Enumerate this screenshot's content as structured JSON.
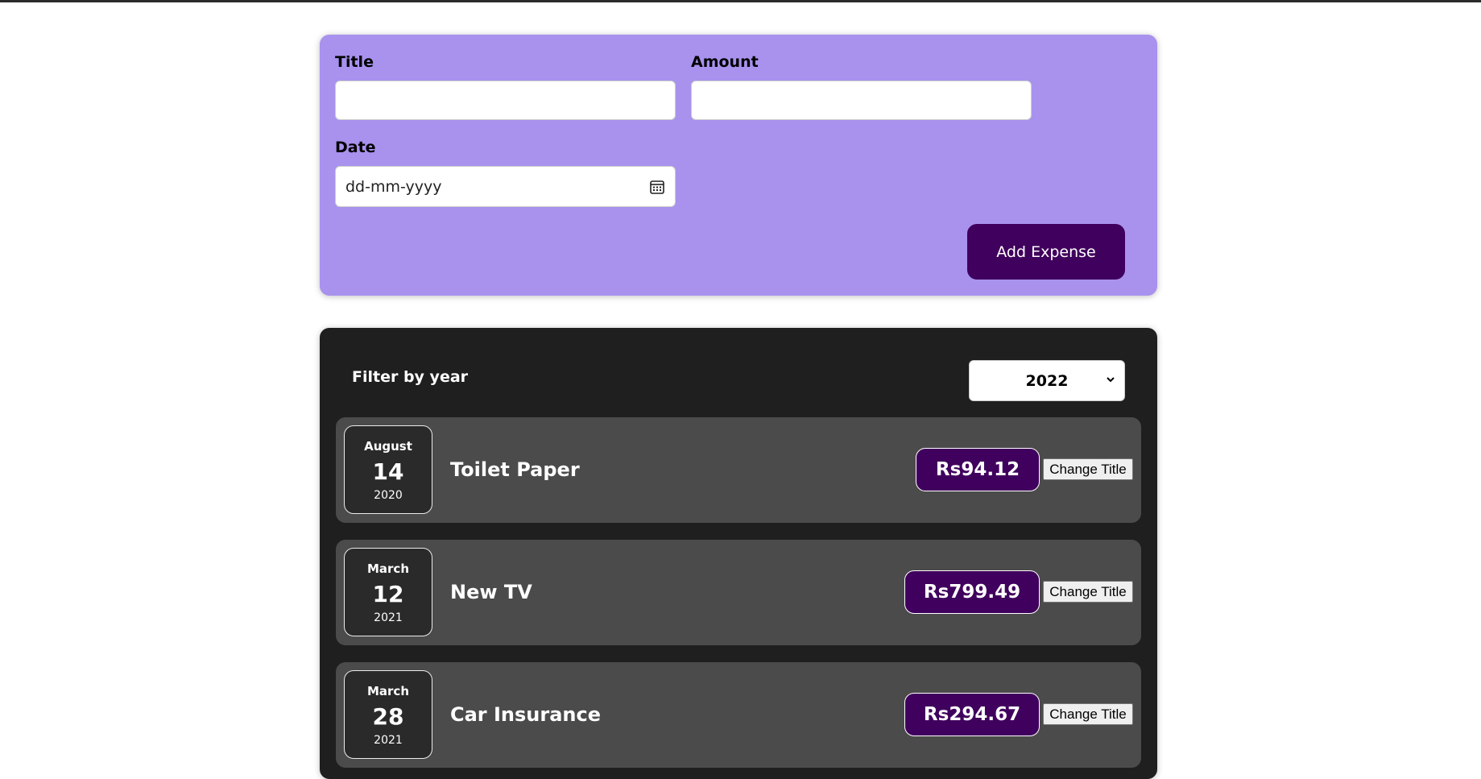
{
  "form": {
    "title_label": "Title",
    "amount_label": "Amount",
    "date_label": "Date",
    "title_value": "",
    "amount_value": "",
    "date_placeholder": "dd-mm-yyyy",
    "add_button": "Add Expense",
    "colors": {
      "panel": "#a892ee",
      "button": "#40005d"
    }
  },
  "filter": {
    "label": "Filter by year",
    "selected_year": "2022"
  },
  "expenses": [
    {
      "month": "August",
      "day": "14",
      "year": "2020",
      "title": "Toilet Paper",
      "amount": "Rs94.12",
      "action": "Change Title"
    },
    {
      "month": "March",
      "day": "12",
      "year": "2021",
      "title": "New TV",
      "amount": "Rs799.49",
      "action": "Change Title"
    },
    {
      "month": "March",
      "day": "28",
      "year": "2021",
      "title": "Car Insurance",
      "amount": "Rs294.67",
      "action": "Change Title"
    }
  ]
}
